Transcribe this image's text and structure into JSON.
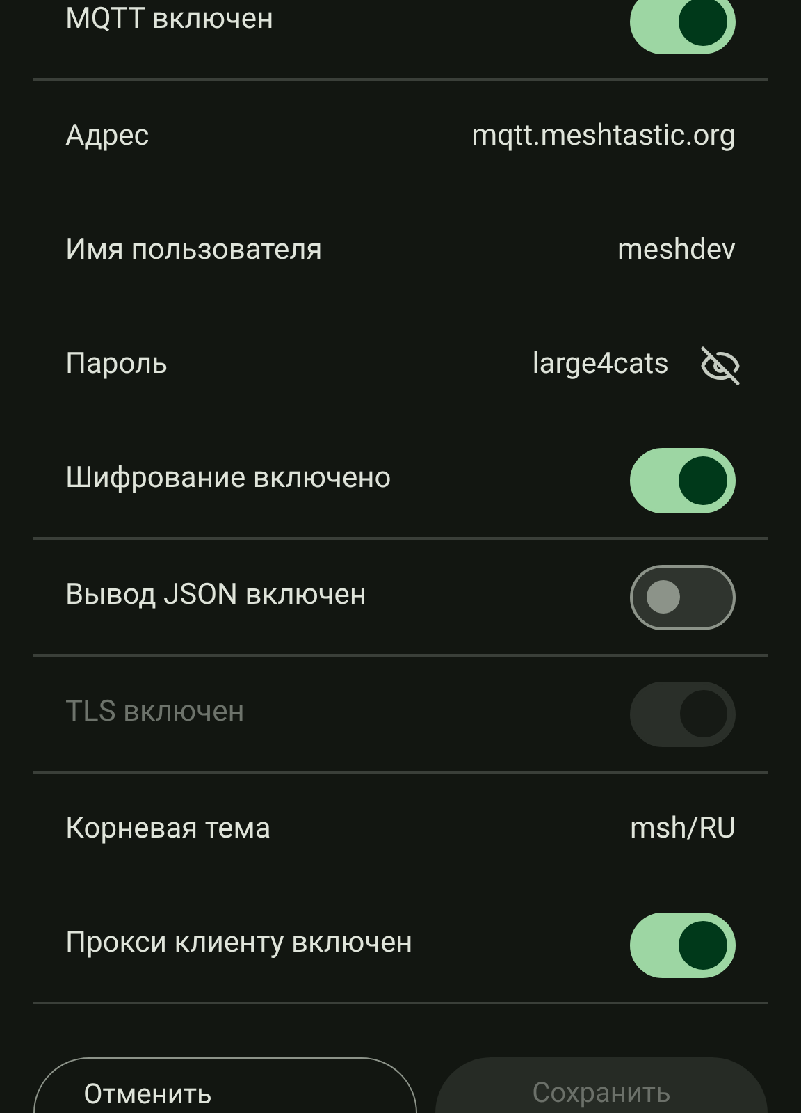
{
  "sections": [
    {
      "rows": [
        {
          "kind": "toggle",
          "label": "MQTT включен",
          "on": true,
          "disabled": false
        }
      ]
    },
    {
      "rows": [
        {
          "kind": "text",
          "label": "Адрес",
          "value": "mqtt.meshtastic.org"
        },
        {
          "kind": "text",
          "label": "Имя пользователя",
          "value": "meshdev"
        },
        {
          "kind": "password",
          "label": "Пароль",
          "value": "large4cats"
        },
        {
          "kind": "toggle",
          "label": "Шифрование включено",
          "on": true,
          "disabled": false
        }
      ]
    },
    {
      "rows": [
        {
          "kind": "toggle",
          "label": "Вывод JSON включен",
          "on": false,
          "disabled": false
        }
      ]
    },
    {
      "rows": [
        {
          "kind": "toggle",
          "label": "TLS включен",
          "on": true,
          "disabled": true
        }
      ]
    },
    {
      "rows": [
        {
          "kind": "text",
          "label": "Корневая тема",
          "value": "msh/RU"
        },
        {
          "kind": "toggle",
          "label": "Прокси клиенту включен",
          "on": true,
          "disabled": false
        }
      ]
    }
  ],
  "buttons": [
    {
      "label": "Отменить",
      "kind": "outlined",
      "disabled": false
    },
    {
      "label": "Сохранить",
      "kind": "filled",
      "disabled": true
    }
  ]
}
